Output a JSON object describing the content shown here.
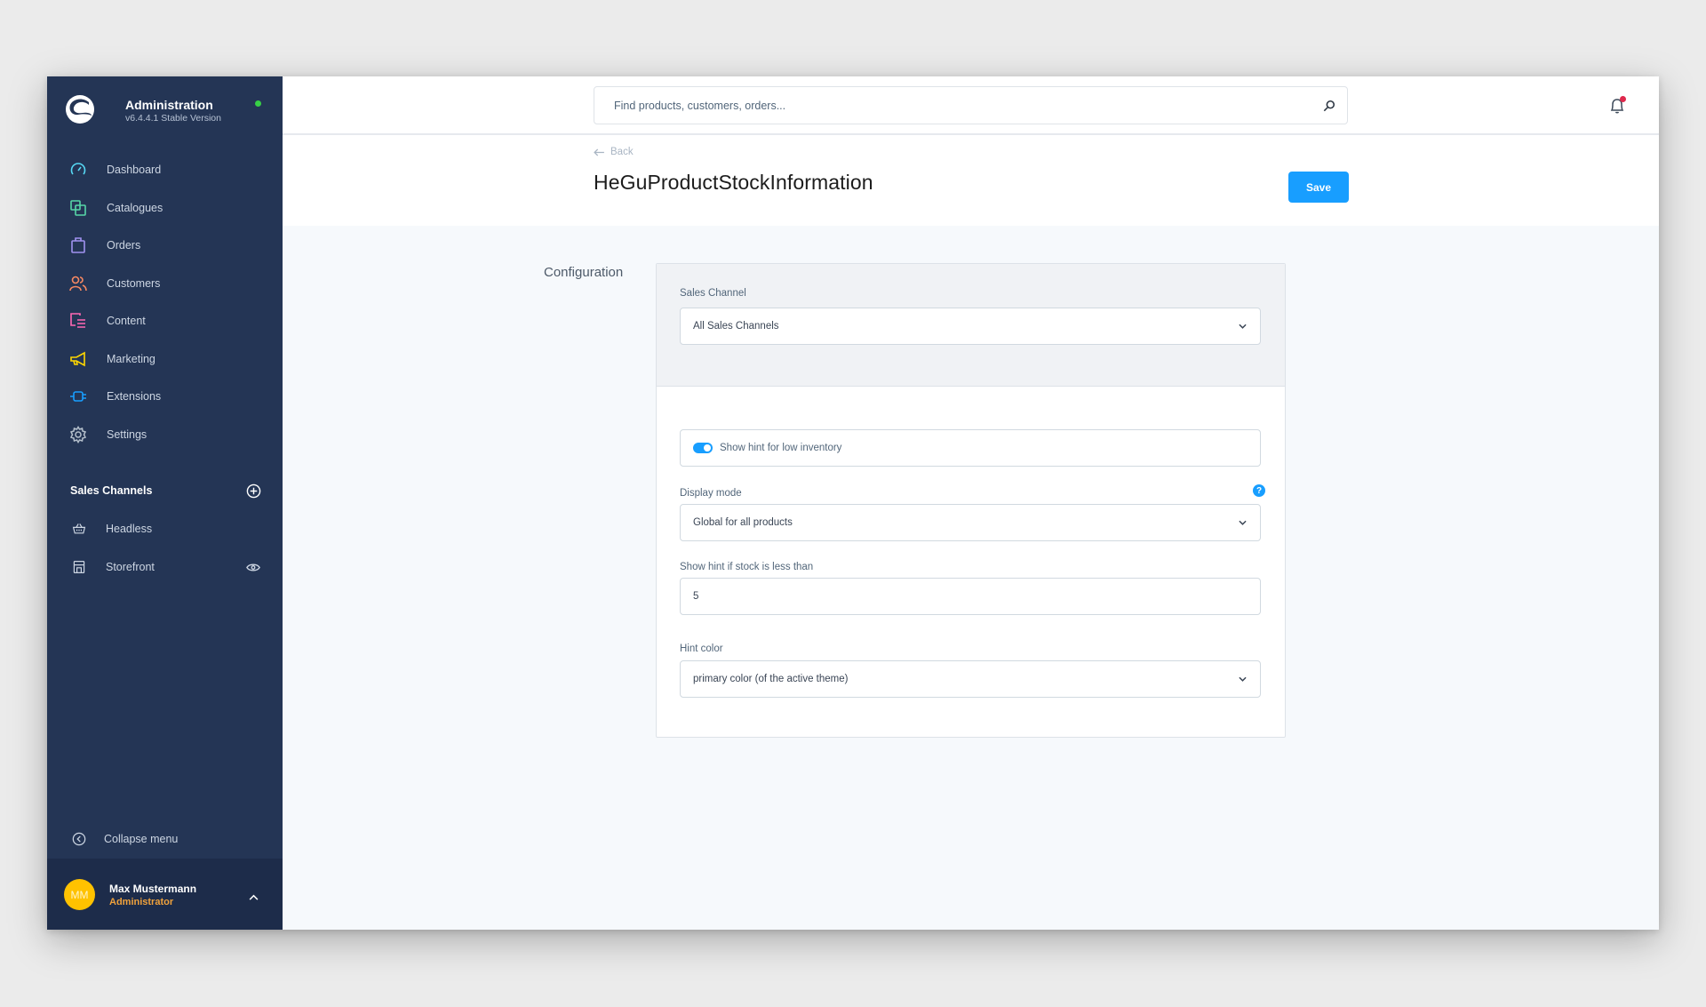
{
  "sidebar": {
    "brand_title": "Administration",
    "brand_version": "v6.4.4.1 Stable Version",
    "status_color": "#37d046",
    "items": [
      {
        "label": "Dashboard",
        "icon": "dashboard-icon",
        "color": "#57d9f5"
      },
      {
        "label": "Catalogues",
        "icon": "catalogues-icon",
        "color": "#57d6a8"
      },
      {
        "label": "Orders",
        "icon": "orders-icon",
        "color": "#a092f0"
      },
      {
        "label": "Customers",
        "icon": "customers-icon",
        "color": "#f88962"
      },
      {
        "label": "Content",
        "icon": "content-icon",
        "color": "#ff68b4"
      },
      {
        "label": "Marketing",
        "icon": "marketing-icon",
        "color": "#ffd700"
      },
      {
        "label": "Extensions",
        "icon": "extensions-icon",
        "color": "#189eff"
      },
      {
        "label": "Settings",
        "icon": "settings-icon",
        "color": "#9aa8b5"
      }
    ],
    "sales_channels_title": "Sales Channels",
    "sales_channels": [
      {
        "label": "Headless",
        "icon": "basket-icon"
      },
      {
        "label": "Storefront",
        "icon": "storefront-icon"
      }
    ],
    "collapse_label": "Collapse menu",
    "user": {
      "initials": "MM",
      "name": "Max Mustermann",
      "role": "Administrator"
    }
  },
  "topbar": {
    "search_placeholder": "Find products, customers, orders..."
  },
  "page": {
    "back_label": "Back",
    "title": "HeGuProductStockInformation",
    "save_label": "Save",
    "accent_color": "#189eff"
  },
  "config": {
    "section_label": "Configuration",
    "sales_channel_label": "Sales Channel",
    "sales_channel_value": "All Sales Channels",
    "toggle_label": "Show hint for low inventory",
    "toggle_on": true,
    "display_mode_label": "Display mode",
    "display_mode_value": "Global for all products",
    "help_glyph": "?",
    "threshold_label": "Show hint if stock is less than",
    "threshold_value": "5",
    "hint_color_label": "Hint color",
    "hint_color_value": "primary color (of the active theme)"
  }
}
